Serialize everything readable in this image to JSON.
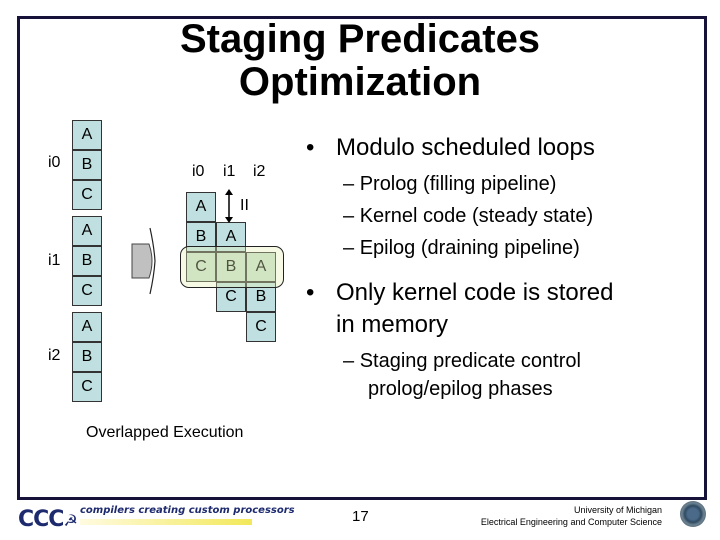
{
  "title": {
    "line1": "Staging Predicates",
    "line2": "Optimization"
  },
  "left_diagram": {
    "iterations": [
      {
        "label": "i0",
        "stages": [
          "A",
          "B",
          "C"
        ]
      },
      {
        "label": "i1",
        "stages": [
          "A",
          "B",
          "C"
        ]
      },
      {
        "label": "i2",
        "stages": [
          "A",
          "B",
          "C"
        ]
      }
    ],
    "caption": "Overlapped Execution"
  },
  "right_diagram": {
    "column_labels": [
      "i0",
      "i1",
      "i2"
    ],
    "ii_label": "II",
    "rows": [
      [
        "A",
        "",
        ""
      ],
      [
        "B",
        "A",
        ""
      ],
      [
        "C",
        "B",
        "A"
      ],
      [
        "",
        "C",
        "B"
      ],
      [
        "",
        "",
        "C"
      ]
    ],
    "kernel_row_index": 2
  },
  "bullets": [
    {
      "text": "Modulo scheduled loops",
      "subs": [
        "Prolog (filling pipeline)",
        "Kernel code (steady state)",
        "Epilog (draining pipeline)"
      ]
    },
    {
      "text_line1": "Only kernel code is stored",
      "text_line2": "in memory",
      "subs": [
        "Staging predicate control",
        "prolog/epilog phases"
      ]
    }
  ],
  "footer": {
    "logo": "CCC",
    "tagline": "compilers creating custom processors",
    "page_number": "17",
    "university": "University of Michigan",
    "department": "Electrical Engineering and Computer Science"
  },
  "colors": {
    "box_fill": "#bfdfe0",
    "frame": "#16123a",
    "logo": "#1d2a6e"
  }
}
